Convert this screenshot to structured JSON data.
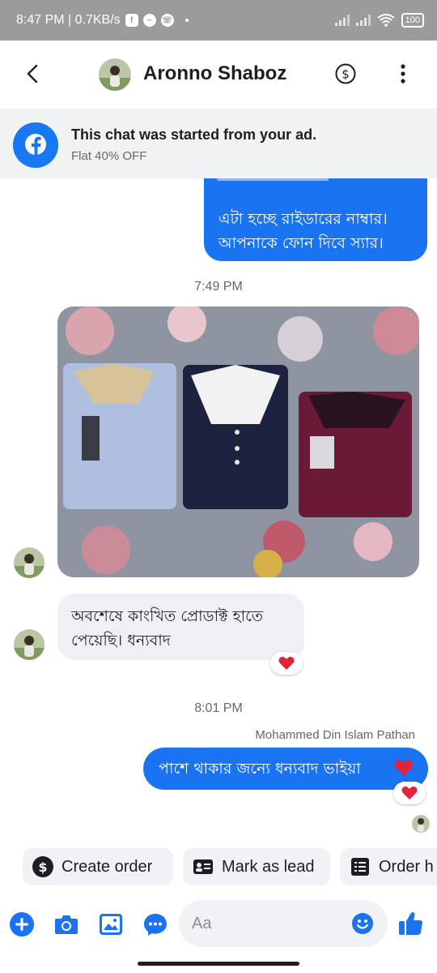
{
  "status_bar": {
    "time_speed": "8:47 PM | 0.7KB/s",
    "battery": "100"
  },
  "header": {
    "contact_name": "Aronno Shaboz"
  },
  "ad_banner": {
    "title": "This chat was started from your ad.",
    "subtitle": "Flat 40% OFF"
  },
  "messages": {
    "outgoing_1": {
      "line1": "এটা হচ্ছে রাইডারের নাম্বার।",
      "line2": "আপনাকে ফোন দিবে স্যার।"
    },
    "timestamp_1": "7:49 PM",
    "incoming_text": {
      "line1": "অবশেষে কাংখিত প্রোডাক্ট হাতে",
      "line2": "পেয়েছি। ধন্যবাদ"
    },
    "timestamp_2": "8:01 PM",
    "sender_name": "Mohammed Din Islam Pathan",
    "outgoing_2": "পাশে থাকার জন্যে ধন্যবাদ ভাইয়া"
  },
  "quick_actions": [
    {
      "label": "Create order",
      "icon": "dollar-circle-icon"
    },
    {
      "label": "Mark as lead",
      "icon": "contact-card-icon"
    },
    {
      "label": "Order h",
      "icon": "list-document-icon"
    }
  ],
  "composer": {
    "placeholder": "Aa"
  },
  "colors": {
    "accent": "#1a73f0",
    "facebook_blue": "#1877f2",
    "heart": "#e0243b"
  }
}
